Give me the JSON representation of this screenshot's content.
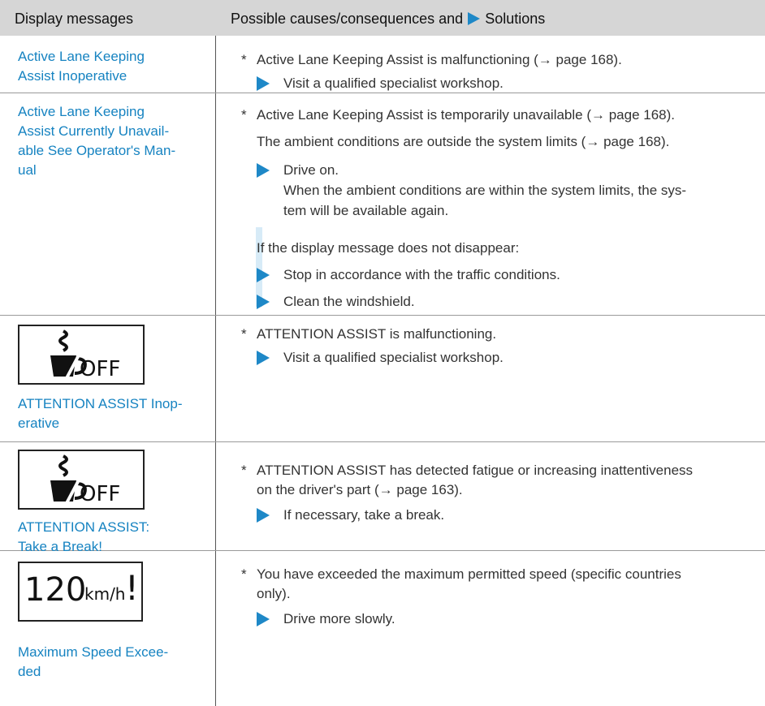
{
  "header": {
    "col1": "Display messages",
    "col2_prefix": "Possible causes/consequences and",
    "col2_suffix": "Solutions"
  },
  "rows": [
    {
      "message": [
        "Active Lane Keeping",
        "Assist Inoperative"
      ],
      "lines": [
        {
          "kind": "star",
          "text": "Active Lane Keeping Assist is malfunctioning (→ page 168)."
        },
        {
          "kind": "step",
          "text": "Visit a qualified specialist workshop."
        }
      ]
    },
    {
      "message": [
        "Active Lane Keeping",
        "Assist Currently Unavail-",
        "able See Operator's Man-",
        "ual"
      ],
      "lines": [
        {
          "kind": "star",
          "text": "Active Lane Keeping Assist is temporarily unavailable (→ page 168)."
        },
        {
          "kind": "plain",
          "text": "The ambient conditions are outside the system limits (→ page 168)."
        },
        {
          "kind": "step",
          "text": "Drive on."
        },
        {
          "kind": "plain",
          "text": "When the ambient conditions are within the system limits, the sys-"
        },
        {
          "kind": "plain",
          "text": "tem will be available again."
        },
        {
          "kind": "plain",
          "text": "If the display message does not disappear:"
        },
        {
          "kind": "step",
          "text": "Stop in accordance with the traffic conditions."
        },
        {
          "kind": "step",
          "text": "Clean the windshield."
        }
      ]
    },
    {
      "icon": "coffee-cup-off-icon",
      "icon_text": "OFF",
      "message": [
        "ATTENTION ASSIST Inop-",
        "erative"
      ],
      "lines": [
        {
          "kind": "star",
          "text": "ATTENTION ASSIST is malfunctioning."
        },
        {
          "kind": "step",
          "text": "Visit a qualified specialist workshop."
        }
      ]
    },
    {
      "icon": "coffee-cup-off-icon",
      "icon_text": "OFF",
      "message": [
        "ATTENTION ASSIST:",
        "Take a Break!"
      ],
      "lines": [
        {
          "kind": "star",
          "text": "ATTENTION ASSIST has detected fatigue or increasing inattentiveness"
        },
        {
          "kind": "plain",
          "text": "on the driver's part (→ page 163)."
        },
        {
          "kind": "step",
          "text": "If necessary, take a break."
        }
      ]
    },
    {
      "speed_display": {
        "value": "120",
        "unit": "km/h",
        "mark": "!"
      },
      "message": [
        "Maximum Speed Excee-",
        "ded"
      ],
      "lines": [
        {
          "kind": "star",
          "text": "You have exceeded the maximum permitted speed (specific countries"
        },
        {
          "kind": "plain",
          "text": "only)."
        },
        {
          "kind": "step",
          "text": "Drive more slowly."
        }
      ]
    }
  ],
  "colors": {
    "accent": "#1e88c7",
    "link": "#1683c1",
    "header_bg": "#d6d6d6"
  }
}
